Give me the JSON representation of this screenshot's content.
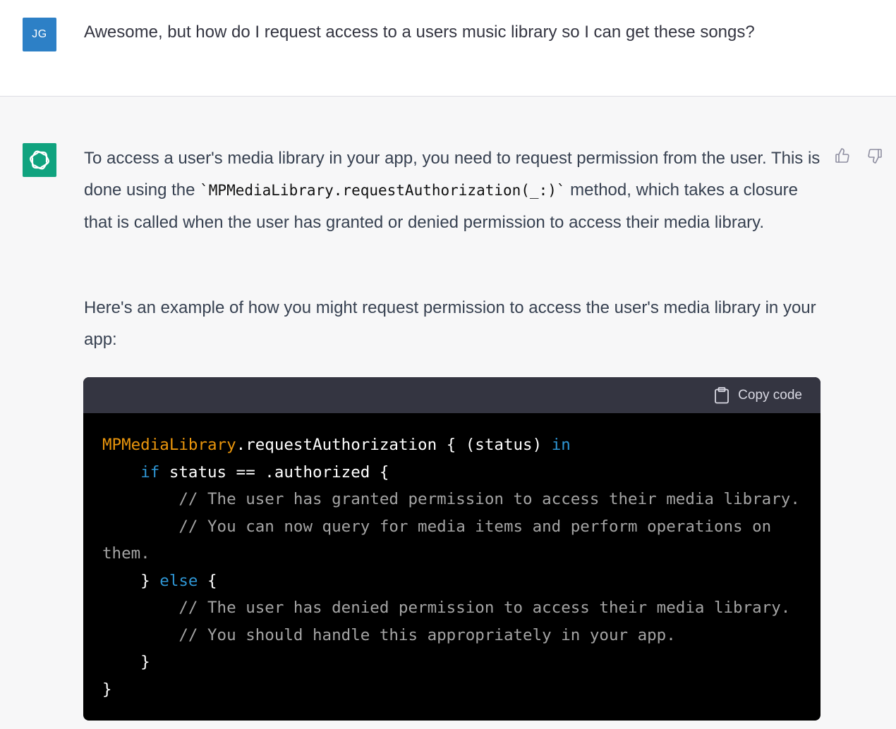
{
  "user_message": {
    "avatar_initials": "JG",
    "text": "Awesome, but how do I request access to a users music library so I can get these songs?"
  },
  "assistant_message": {
    "paragraph1": {
      "part1": "To access a user's media library in your app, you need to request permission from the user. This is done using the ",
      "code": "`MPMediaLibrary.requestAuthorization(_:)`",
      "part2": " method, which takes a closure that is called when the user has granted or denied permission to access their media library."
    },
    "paragraph2": "Here's an example of how you might request permission to access the user's media library in your app:",
    "code_block": {
      "copy_label": "Copy code",
      "lines": {
        "l1_type": "MPMediaLibrary",
        "l1_rest": ".requestAuthorization { (status) ",
        "l1_kw": "in",
        "l2_indent": "    ",
        "l2_kw": "if",
        "l2_rest": " status == .authorized {",
        "l3": "        // The user has granted permission to access their media library.",
        "l4": "        // You can now query for media items and perform operations on",
        "l5": "them.",
        "l6_start": "    } ",
        "l6_kw": "else",
        "l6_end": " {",
        "l7": "        // The user has denied permission to access their media library.",
        "l8": "        // You should handle this appropriately in your app.",
        "l9": "    }",
        "l10": "}"
      }
    }
  },
  "colors": {
    "user_avatar": "#2d80c6",
    "assistant_avatar": "#10a37f",
    "code_type": "#e9950c",
    "code_keyword": "#2e95d3",
    "code_comment": "#a4a4a4"
  }
}
